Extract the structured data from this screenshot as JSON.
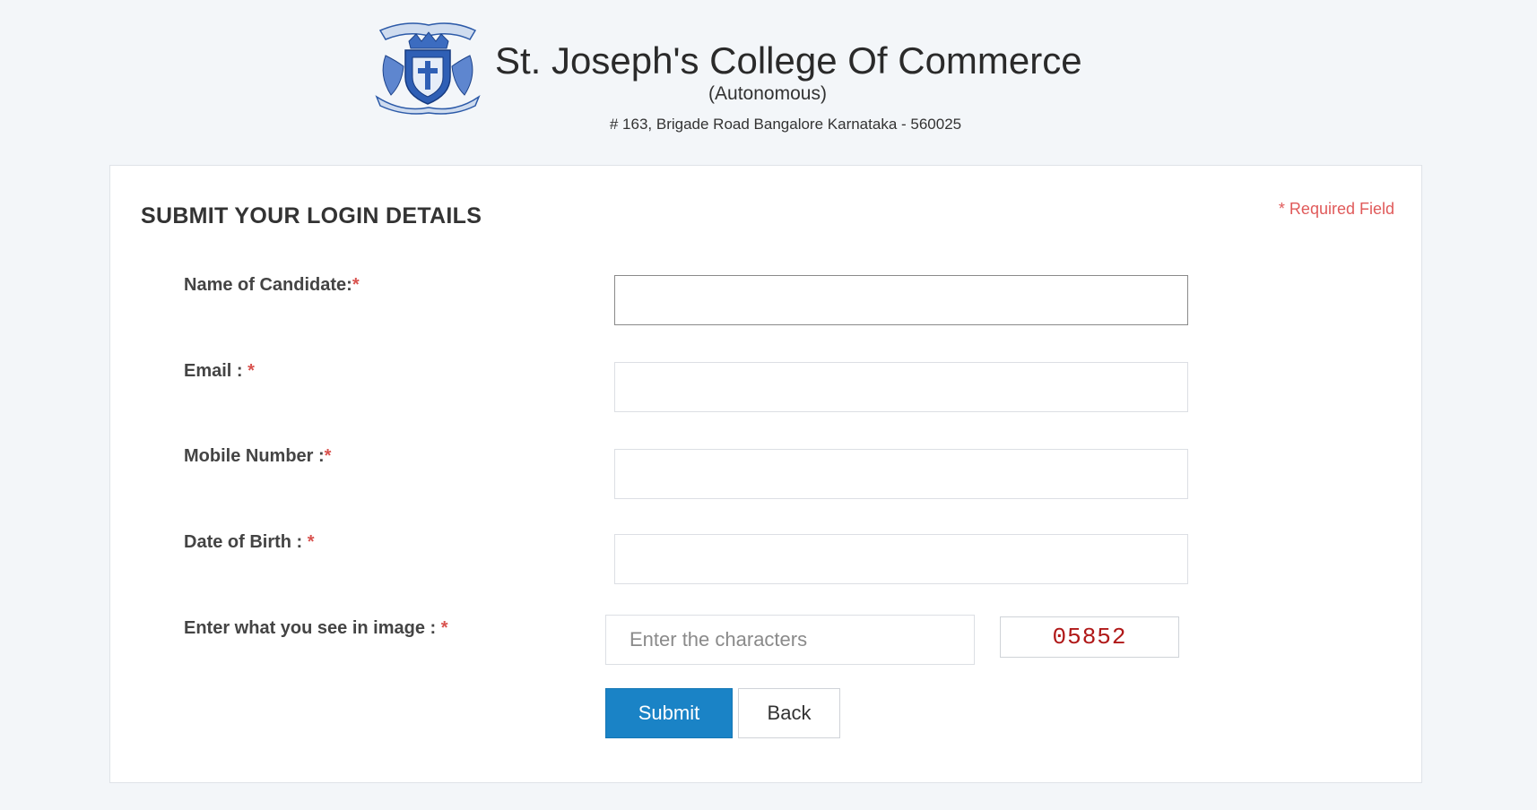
{
  "header": {
    "college_name": "St. Joseph's College Of Commerce",
    "college_status": "(Autonomous)",
    "address": "# 163, Brigade Road Bangalore Karnataka - 560025",
    "logo_icon": "college-crest-icon"
  },
  "form": {
    "title": "SUBMIT YOUR LOGIN DETAILS",
    "required_note": "* Required Field",
    "required_marker": "*",
    "fields": [
      {
        "label": "Name of Candidate:",
        "value": ""
      },
      {
        "label": "Email : ",
        "value": ""
      },
      {
        "label": "Mobile Number :",
        "value": ""
      },
      {
        "label": "Date of Birth : ",
        "value": ""
      },
      {
        "label": "Enter what you see in image : ",
        "value": "",
        "placeholder": "Enter the characters"
      }
    ],
    "captcha_text": "05852",
    "submit_label": "Submit",
    "back_label": "Back"
  },
  "colors": {
    "accent": "#1a83c6",
    "required": "#d9534f",
    "captcha": "#b01818",
    "background": "#f3f6f9"
  }
}
